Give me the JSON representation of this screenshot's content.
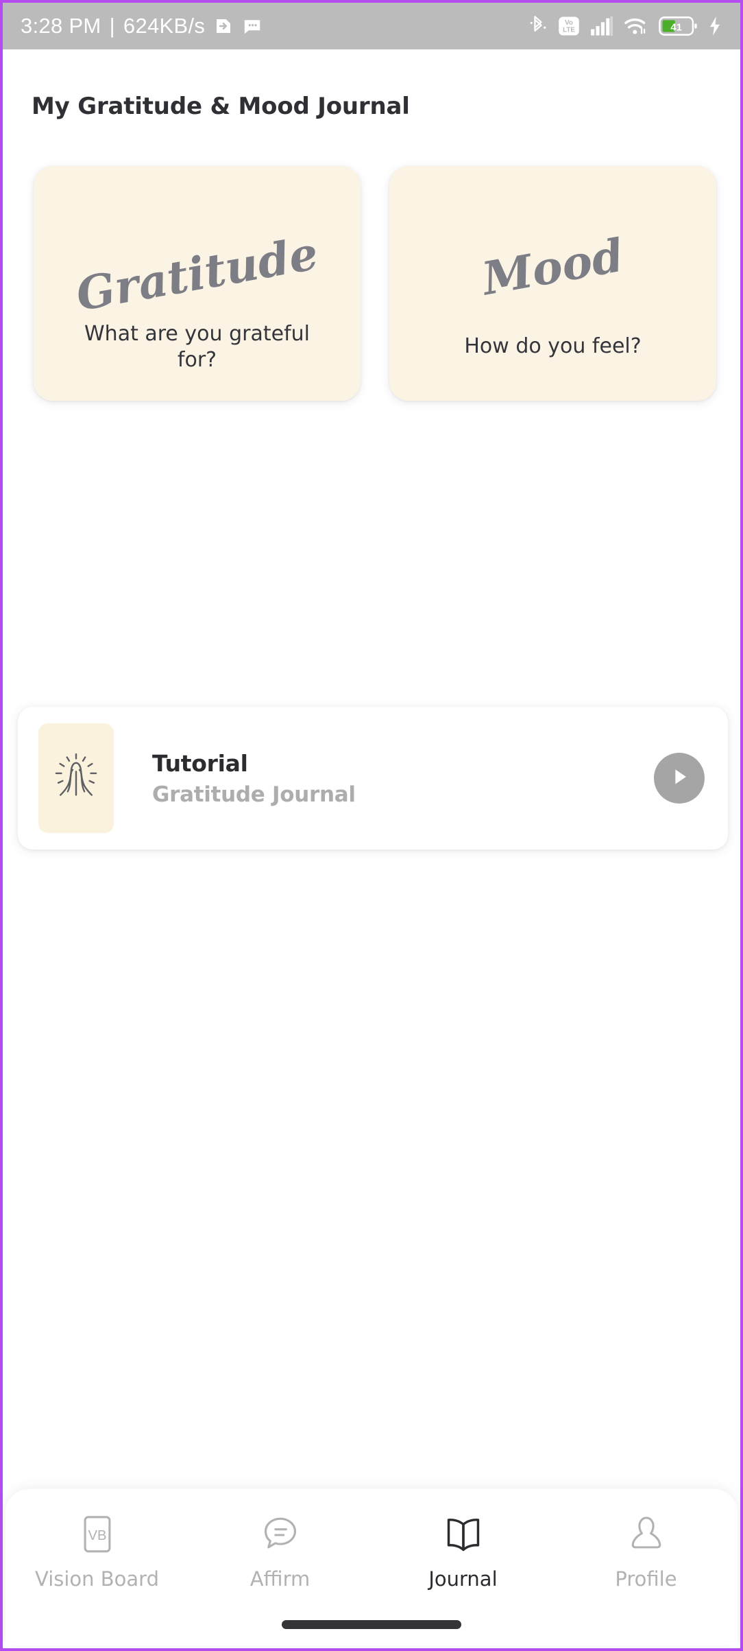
{
  "status_bar": {
    "time": "3:28 PM",
    "separator": "|",
    "network_speed": "624KB/s",
    "left_icons": [
      "screenshot-icon",
      "message-icon"
    ],
    "right_icons": [
      "bluetooth-icon",
      "volte-icon",
      "signal-icon",
      "wifi-icon",
      "battery-icon",
      "charging-icon"
    ],
    "volte_label_top": "Vo",
    "volte_label_bottom": "LTE",
    "battery_percent": "41",
    "battery_color": "#4caf2b",
    "background_color": "#bbbbbb"
  },
  "header": {
    "title": "My Gratitude & Mood Journal"
  },
  "cards": [
    {
      "id": "gratitude",
      "script_label": "Gratitude",
      "question": "What are you grateful for?",
      "background_color": "#fbf4e4",
      "script_color": "#7c7d85"
    },
    {
      "id": "mood",
      "script_label": "Mood",
      "question": "How do you feel?",
      "background_color": "#fbf4e4",
      "script_color": "#7c7d85"
    }
  ],
  "tutorial": {
    "thumbnail_icon": "praying-hands-icon",
    "title": "Tutorial",
    "subtitle": "Gratitude Journal",
    "play_icon": "play-icon",
    "play_button_color": "#a5a5a5"
  },
  "bottom_nav": {
    "items": [
      {
        "id": "vision-board",
        "label": "Vision Board",
        "icon": "vision-board-icon",
        "icon_text": "VB",
        "active": false
      },
      {
        "id": "affirm",
        "label": "Affirm",
        "icon": "speech-bubble-icon",
        "active": false
      },
      {
        "id": "journal",
        "label": "Journal",
        "icon": "open-book-icon",
        "active": true
      },
      {
        "id": "profile",
        "label": "Profile",
        "icon": "person-icon",
        "active": false
      }
    ],
    "active_color": "#2b2c30",
    "inactive_color": "#b2b2b2"
  }
}
